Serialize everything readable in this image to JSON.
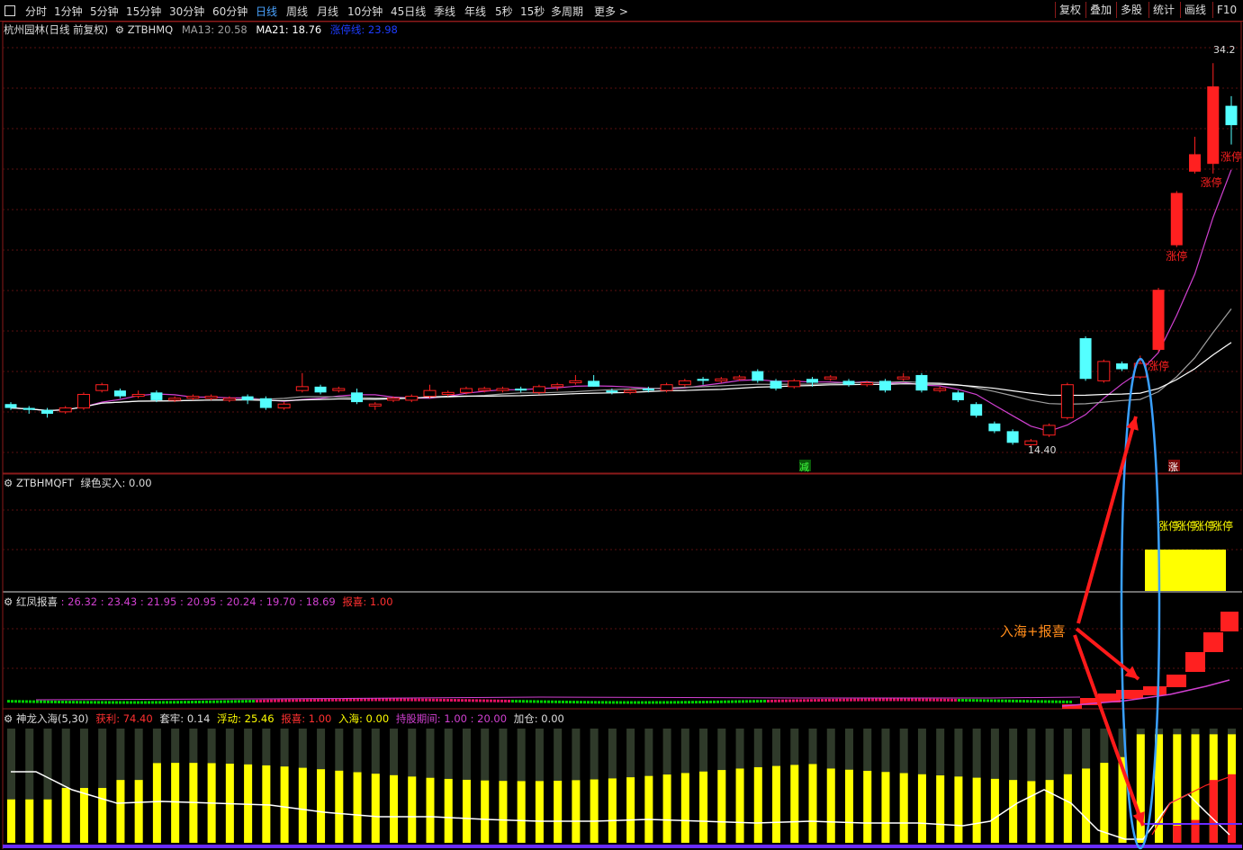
{
  "toolbar": {
    "items": [
      "分时",
      "1分钟",
      "5分钟",
      "15分钟",
      "30分钟",
      "60分钟",
      "日线",
      "周线",
      "月线",
      "10分钟",
      "45日线",
      "季线",
      "年线",
      "5秒",
      "15秒",
      "多周期",
      "更多 >"
    ],
    "active": "日线",
    "right_items": [
      "复权",
      "叠加",
      "多股",
      "统计",
      "画线",
      "F10"
    ]
  },
  "main_pane": {
    "stock": "杭州园林(日线 前复权)",
    "indicator": "ZTBHMQ",
    "ma13_label": "MA13: 20.58",
    "ma21_label": "MA21: 18.76",
    "extra_label": "涨停线: 23.98",
    "high_label": "34.2",
    "low_label": "14.40",
    "limit_up_label": "涨停",
    "marker_jian": "减",
    "marker_zhang": "涨"
  },
  "pane2": {
    "indicator": "ZTBHMQFT",
    "label": "绿色买入: 0.00",
    "limit_labels": [
      "涨停",
      "涨停",
      "涨停",
      "涨停"
    ]
  },
  "pane3": {
    "indicator": "红凤报喜",
    "values": ": 26.32 : 23.43 : 21.95 : 20.95 : 20.24 : 19.70 : 18.69",
    "bao_label": "报喜: 1.00",
    "annotation": "入海+报喜"
  },
  "pane4": {
    "indicator": "神龙入海(5,30)",
    "huoli": "获利: 74.40",
    "taolao": "套牢: 0.14",
    "fudong": "浮动: 25.46",
    "baoxi": "报喜: 1.00",
    "ruhai": "入海: 0.00",
    "chigu": "持股期间: 1.00 : 20.00",
    "jiacang": "加仓: 0.00"
  },
  "colors": {
    "up": "#ff2020",
    "down": "#54ffff",
    "frame": "#8b1a1a",
    "ma_purple": "#d040d0",
    "ma_gray": "#a0a0a0",
    "ma_white": "#ffffff",
    "yellow": "#ffff00",
    "green": "#00d000",
    "annot": "#ff8c1a",
    "ellipse": "#3aa0ff"
  },
  "chart_data": {
    "type": "candlestick",
    "title": "杭州园林(日线 前复权)",
    "price_range": [
      13.5,
      35
    ],
    "visible_high": 34.2,
    "visible_low": 14.4,
    "ma13_last": 20.58,
    "ma21_last": 18.76,
    "candles": [
      {
        "o": 16.6,
        "c": 16.4,
        "h": 16.7,
        "l": 16.3
      },
      {
        "o": 16.4,
        "c": 16.3,
        "h": 16.5,
        "l": 16.1
      },
      {
        "o": 16.3,
        "c": 16.1,
        "h": 16.4,
        "l": 15.9
      },
      {
        "o": 16.2,
        "c": 16.4,
        "h": 16.5,
        "l": 16.1
      },
      {
        "o": 16.4,
        "c": 17.1,
        "h": 17.2,
        "l": 16.3
      },
      {
        "o": 17.3,
        "c": 17.6,
        "h": 17.7,
        "l": 17.2
      },
      {
        "o": 17.3,
        "c": 17.0,
        "h": 17.4,
        "l": 16.9
      },
      {
        "o": 17.0,
        "c": 17.1,
        "h": 17.3,
        "l": 16.9
      },
      {
        "o": 17.2,
        "c": 16.8,
        "h": 17.3,
        "l": 16.7
      },
      {
        "o": 16.8,
        "c": 16.9,
        "h": 17.0,
        "l": 16.7
      },
      {
        "o": 16.9,
        "c": 17.0,
        "h": 17.1,
        "l": 16.8
      },
      {
        "o": 16.9,
        "c": 17.0,
        "h": 17.1,
        "l": 16.8
      },
      {
        "o": 16.8,
        "c": 16.9,
        "h": 17.0,
        "l": 16.7
      },
      {
        "o": 17.0,
        "c": 16.8,
        "h": 17.1,
        "l": 16.6
      },
      {
        "o": 16.9,
        "c": 16.4,
        "h": 17.0,
        "l": 16.3
      },
      {
        "o": 16.4,
        "c": 16.6,
        "h": 16.7,
        "l": 16.3
      },
      {
        "o": 17.3,
        "c": 17.5,
        "h": 18.2,
        "l": 17.2
      },
      {
        "o": 17.5,
        "c": 17.2,
        "h": 17.6,
        "l": 17.1
      },
      {
        "o": 17.3,
        "c": 17.4,
        "h": 17.5,
        "l": 17.2
      },
      {
        "o": 17.2,
        "c": 16.7,
        "h": 17.4,
        "l": 16.6
      },
      {
        "o": 16.5,
        "c": 16.6,
        "h": 16.7,
        "l": 16.3
      },
      {
        "o": 16.8,
        "c": 16.9,
        "h": 17.0,
        "l": 16.7
      },
      {
        "o": 16.8,
        "c": 17.0,
        "h": 17.1,
        "l": 16.7
      },
      {
        "o": 17.0,
        "c": 17.3,
        "h": 17.6,
        "l": 16.9
      },
      {
        "o": 17.1,
        "c": 17.2,
        "h": 17.3,
        "l": 17.0
      },
      {
        "o": 17.2,
        "c": 17.4,
        "h": 17.5,
        "l": 17.1
      },
      {
        "o": 17.3,
        "c": 17.4,
        "h": 17.5,
        "l": 17.2
      },
      {
        "o": 17.3,
        "c": 17.4,
        "h": 17.5,
        "l": 17.2
      },
      {
        "o": 17.4,
        "c": 17.3,
        "h": 17.5,
        "l": 17.2
      },
      {
        "o": 17.2,
        "c": 17.5,
        "h": 17.6,
        "l": 17.1
      },
      {
        "o": 17.5,
        "c": 17.6,
        "h": 17.7,
        "l": 17.3
      },
      {
        "o": 17.7,
        "c": 17.8,
        "h": 18.1,
        "l": 17.6
      },
      {
        "o": 17.8,
        "c": 17.5,
        "h": 18.1,
        "l": 17.5
      },
      {
        "o": 17.3,
        "c": 17.2,
        "h": 17.4,
        "l": 17.1
      },
      {
        "o": 17.2,
        "c": 17.3,
        "h": 17.4,
        "l": 17.1
      },
      {
        "o": 17.4,
        "c": 17.3,
        "h": 17.5,
        "l": 17.2
      },
      {
        "o": 17.3,
        "c": 17.6,
        "h": 17.7,
        "l": 17.2
      },
      {
        "o": 17.6,
        "c": 17.8,
        "h": 17.9,
        "l": 17.5
      },
      {
        "o": 17.9,
        "c": 17.8,
        "h": 18.0,
        "l": 17.6
      },
      {
        "o": 17.8,
        "c": 17.9,
        "h": 18.0,
        "l": 17.7
      },
      {
        "o": 17.9,
        "c": 18.0,
        "h": 18.1,
        "l": 17.8
      },
      {
        "o": 18.3,
        "c": 17.8,
        "h": 18.4,
        "l": 17.7
      },
      {
        "o": 17.8,
        "c": 17.4,
        "h": 17.9,
        "l": 17.3
      },
      {
        "o": 17.5,
        "c": 17.8,
        "h": 17.9,
        "l": 17.4
      },
      {
        "o": 17.9,
        "c": 17.7,
        "h": 18.0,
        "l": 17.5
      },
      {
        "o": 17.9,
        "c": 18.0,
        "h": 18.1,
        "l": 17.8
      },
      {
        "o": 17.8,
        "c": 17.6,
        "h": 17.9,
        "l": 17.5
      },
      {
        "o": 17.6,
        "c": 17.7,
        "h": 17.8,
        "l": 17.5
      },
      {
        "o": 17.8,
        "c": 17.3,
        "h": 17.9,
        "l": 17.2
      },
      {
        "o": 17.9,
        "c": 18.0,
        "h": 18.2,
        "l": 17.8
      },
      {
        "o": 18.1,
        "c": 17.3,
        "h": 18.2,
        "l": 17.2
      },
      {
        "o": 17.3,
        "c": 17.4,
        "h": 17.5,
        "l": 17.2
      },
      {
        "o": 17.2,
        "c": 16.8,
        "h": 17.3,
        "l": 16.7
      },
      {
        "o": 16.6,
        "c": 16.0,
        "h": 16.7,
        "l": 15.9
      },
      {
        "o": 15.6,
        "c": 15.2,
        "h": 15.7,
        "l": 15.1
      },
      {
        "o": 15.2,
        "c": 14.6,
        "h": 15.3,
        "l": 14.5
      },
      {
        "o": 14.5,
        "c": 14.7,
        "h": 14.8,
        "l": 14.4
      },
      {
        "o": 15.0,
        "c": 15.5,
        "h": 15.6,
        "l": 14.9
      },
      {
        "o": 15.9,
        "c": 17.6,
        "h": 17.7,
        "l": 15.8
      },
      {
        "o": 20.0,
        "c": 17.9,
        "h": 20.1,
        "l": 17.8
      },
      {
        "o": 17.8,
        "c": 18.8,
        "h": 18.9,
        "l": 17.7
      },
      {
        "o": 18.7,
        "c": 18.4,
        "h": 18.8,
        "l": 18.3
      },
      {
        "o": 18.0,
        "c": 18.7,
        "h": 19.1,
        "l": 17.9
      },
      {
        "o": 19.4,
        "c": 22.5,
        "h": 22.6,
        "l": 19.3
      },
      {
        "o": 24.8,
        "c": 27.5,
        "h": 27.6,
        "l": 24.7
      },
      {
        "o": 28.6,
        "c": 29.5,
        "h": 30.4,
        "l": 28.5
      },
      {
        "o": 29.0,
        "c": 33.0,
        "h": 34.2,
        "l": 28.5
      },
      {
        "o": 32.0,
        "c": 31.0,
        "h": 32.5,
        "l": 30.0
      }
    ]
  }
}
